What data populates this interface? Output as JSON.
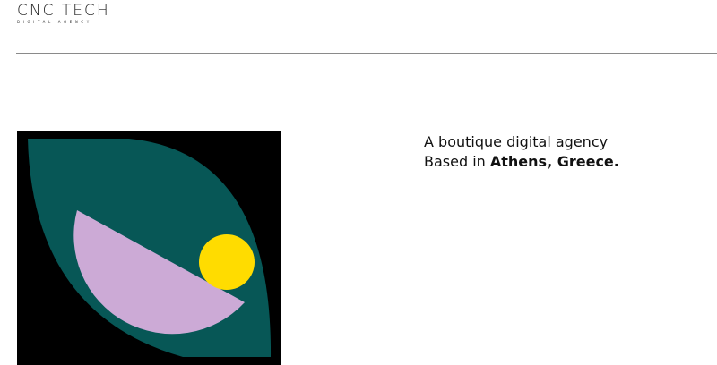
{
  "brand": {
    "name": "CNC TECH",
    "subtitle": "DIGITAL AGENCY"
  },
  "hero": {
    "tagline_line1": "A boutique digital agency",
    "tagline_line2_prefix": "Based in ",
    "tagline_location": "Athens, Greece",
    "tagline_suffix": "."
  },
  "colors": {
    "leaf": "#075756",
    "semicircle": "#ccaad6",
    "sun": "#ffdc00",
    "frame": "#000000"
  }
}
